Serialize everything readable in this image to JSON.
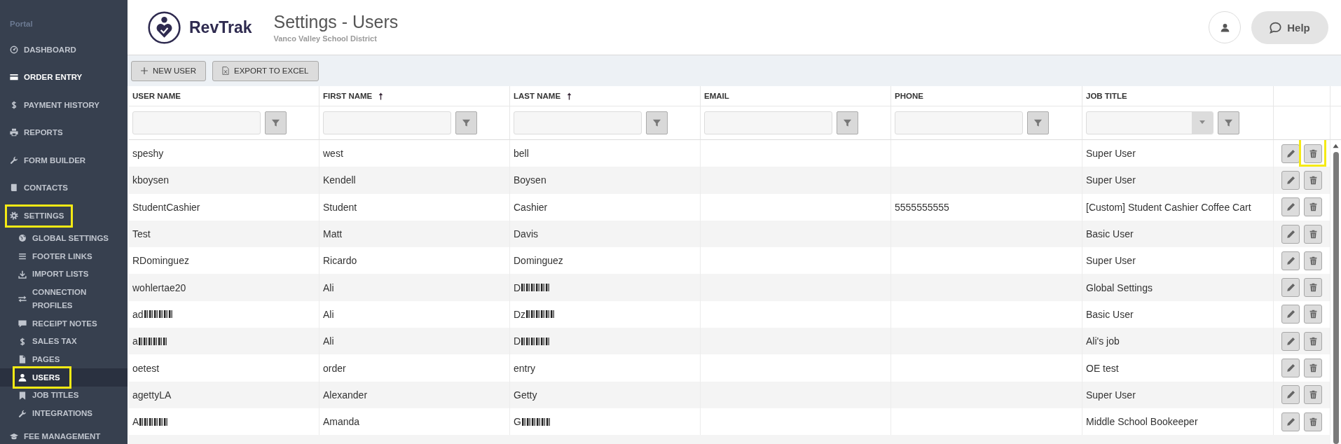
{
  "sidebar": {
    "heading": "Portal",
    "items": [
      {
        "label": "DASHBOARD",
        "selected": false,
        "hovered": false,
        "highlighted": false
      },
      {
        "label": "ORDER ENTRY",
        "selected": false,
        "hovered": true,
        "highlighted": false
      },
      {
        "label": "PAYMENT HISTORY",
        "selected": false,
        "hovered": false,
        "highlighted": false
      },
      {
        "label": "REPORTS",
        "selected": false,
        "hovered": false,
        "highlighted": false
      },
      {
        "label": "FORM BUILDER",
        "selected": false,
        "hovered": false,
        "highlighted": false
      },
      {
        "label": "CONTACTS",
        "selected": false,
        "hovered": false,
        "highlighted": false
      },
      {
        "label": "SETTINGS",
        "selected": false,
        "hovered": false,
        "highlighted": true,
        "children": [
          {
            "label": "GLOBAL SETTINGS",
            "selected": false,
            "highlighted": false
          },
          {
            "label": "FOOTER LINKS",
            "selected": false,
            "highlighted": false
          },
          {
            "label": "IMPORT LISTS",
            "selected": false,
            "highlighted": false
          },
          {
            "label": "CONNECTION PROFILES",
            "selected": false,
            "highlighted": false
          },
          {
            "label": "RECEIPT NOTES",
            "selected": false,
            "highlighted": false
          },
          {
            "label": "SALES TAX",
            "selected": false,
            "highlighted": false
          },
          {
            "label": "PAGES",
            "selected": false,
            "highlighted": false
          },
          {
            "label": "USERS",
            "selected": true,
            "highlighted": true
          },
          {
            "label": "JOB TITLES",
            "selected": false,
            "highlighted": false
          },
          {
            "label": "INTEGRATIONS",
            "selected": false,
            "highlighted": false
          }
        ]
      },
      {
        "label": "FEE MANAGEMENT",
        "selected": false,
        "hovered": false,
        "highlighted": false
      }
    ]
  },
  "header": {
    "logo_text": "RevTrak",
    "title": "Settings - Users",
    "subtitle": "Vanco Valley School District",
    "help_label": "Help"
  },
  "toolbar": {
    "buttons": [
      {
        "label": "NEW USER"
      },
      {
        "label": "EXPORT TO EXCEL"
      }
    ]
  },
  "table": {
    "columns": [
      {
        "label": "USER NAME",
        "sorted": false,
        "kind": "text"
      },
      {
        "label": "FIRST NAME",
        "sorted": true,
        "kind": "text"
      },
      {
        "label": "LAST NAME",
        "sorted": true,
        "kind": "text"
      },
      {
        "label": "EMAIL",
        "sorted": false,
        "kind": "text"
      },
      {
        "label": "PHONE",
        "sorted": false,
        "kind": "text"
      },
      {
        "label": "JOB TITLE",
        "sorted": false,
        "kind": "dropdown"
      }
    ],
    "rows": [
      {
        "user_name": "speshy",
        "user_name_blurred": false,
        "first_name": "west",
        "last_name": "bell",
        "last_name_blurred": false,
        "job_title": "Super User",
        "delete_highlighted": true
      },
      {
        "user_name": "kboysen",
        "user_name_blurred": false,
        "first_name": "Kendell",
        "last_name": "Boysen",
        "last_name_blurred": false,
        "job_title": "Super User",
        "delete_highlighted": false
      },
      {
        "user_name": "StudentCashier",
        "user_name_blurred": false,
        "first_name": "Student",
        "last_name": "Cashier",
        "last_name_blurred": false,
        "phone": "5555555555",
        "job_title": "[Custom] Student Cashier Coffee Cart",
        "delete_highlighted": false
      },
      {
        "user_name": "Test",
        "user_name_blurred": false,
        "first_name": "Matt",
        "last_name": "Davis",
        "last_name_blurred": false,
        "job_title": "Basic User",
        "delete_highlighted": false
      },
      {
        "user_name": "RDominguez",
        "user_name_blurred": false,
        "first_name": "Ricardo",
        "last_name": "Dominguez",
        "last_name_blurred": false,
        "job_title": "Super User",
        "delete_highlighted": false
      },
      {
        "user_name": "wohlertae20",
        "user_name_blurred": false,
        "first_name": "Ali",
        "last_name": "D",
        "last_name_blurred": true,
        "job_title": "Global Settings",
        "delete_highlighted": false
      },
      {
        "user_name": "ad",
        "user_name_blurred": true,
        "first_name": "Ali",
        "last_name": "Dz",
        "last_name_blurred": true,
        "job_title": "Basic User",
        "delete_highlighted": false
      },
      {
        "user_name": "a",
        "user_name_blurred": true,
        "first_name": "Ali",
        "last_name": "D",
        "last_name_blurred": true,
        "job_title": "Ali's job",
        "delete_highlighted": false
      },
      {
        "user_name": "oetest",
        "user_name_blurred": false,
        "first_name": "order",
        "last_name": "entry",
        "last_name_blurred": false,
        "job_title": "OE test",
        "delete_highlighted": false
      },
      {
        "user_name": "agettyLA",
        "user_name_blurred": false,
        "first_name": "Alexander",
        "last_name": "Getty",
        "last_name_blurred": false,
        "job_title": "Super User",
        "delete_highlighted": false
      },
      {
        "user_name": "A",
        "user_name_blurred": true,
        "first_name": "Amanda",
        "last_name": "G",
        "last_name_blurred": true,
        "job_title": "Middle School Bookeeper",
        "delete_highlighted": false
      }
    ]
  }
}
